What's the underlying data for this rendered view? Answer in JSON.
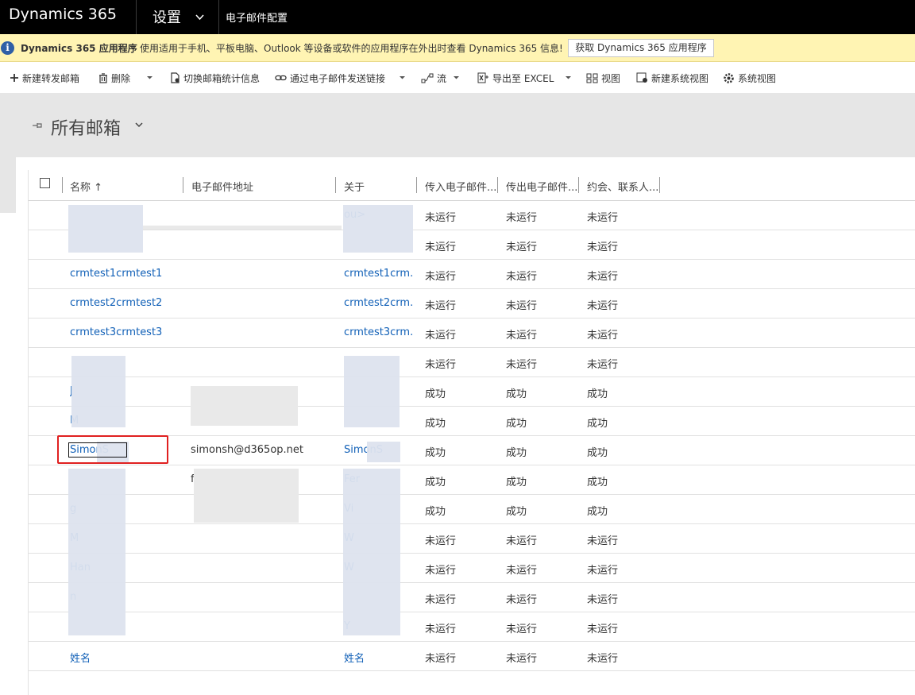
{
  "topbar": {
    "brand": "Dynamics 365",
    "area": "设置",
    "subarea": "电子邮件配置"
  },
  "notification": {
    "title": "Dynamics 365 应用程序",
    "message": "使用适用于手机、平板电脑、Outlook 等设备或软件的应用程序在外出时查看 Dynamics 365 信息!",
    "button": "获取 Dynamics 365 应用程序"
  },
  "toolbar": {
    "new_forward": "新建转发邮箱",
    "delete": "删除",
    "switch_stats": "切换邮箱统计信息",
    "email_link": "通过电子邮件发送链接",
    "flow": "流",
    "export": "导出至 EXCEL",
    "view": "视图",
    "new_system_view": "新建系统视图",
    "system_view": "系统视图"
  },
  "view": {
    "title": "所有邮箱"
  },
  "grid": {
    "columns": [
      "名称 ↑",
      "电子邮件地址",
      "关于",
      "传入电子邮件...",
      "传出电子邮件...",
      "约会、联系人..."
    ],
    "rows": [
      {
        "name": "",
        "email": "",
        "about": "ou>",
        "incoming": "未运行",
        "outgoing": "未运行",
        "appt": "未运行"
      },
      {
        "name": "",
        "email": "",
        "about": "",
        "incoming": "未运行",
        "outgoing": "未运行",
        "appt": "未运行"
      },
      {
        "name": "crmtest1crmtest1",
        "email": "",
        "about": "crmtest1crm...",
        "incoming": "未运行",
        "outgoing": "未运行",
        "appt": "未运行"
      },
      {
        "name": "crmtest2crmtest2",
        "email": "",
        "about": "crmtest2crm...",
        "incoming": "未运行",
        "outgoing": "未运行",
        "appt": "未运行"
      },
      {
        "name": "crmtest3crmtest3",
        "email": "",
        "about": "crmtest3crm...",
        "incoming": "未运行",
        "outgoing": "未运行",
        "appt": "未运行"
      },
      {
        "name": "",
        "email": "",
        "about": "",
        "incoming": "未运行",
        "outgoing": "未运行",
        "appt": "未运行"
      },
      {
        "name": "J",
        "email": "",
        "about": "",
        "incoming": "成功",
        "outgoing": "成功",
        "appt": "成功"
      },
      {
        "name": "M",
        "email": "",
        "about": "",
        "incoming": "成功",
        "outgoing": "成功",
        "appt": "成功"
      },
      {
        "name": "SimonS",
        "email": "simonsh@d365op.net",
        "about": "SimonS",
        "incoming": "成功",
        "outgoing": "成功",
        "appt": "成功"
      },
      {
        "name": "",
        "email": "f",
        "about": "Fer",
        "incoming": "成功",
        "outgoing": "成功",
        "appt": "成功"
      },
      {
        "name": "g",
        "email": "",
        "about": "Vi",
        "incoming": "成功",
        "outgoing": "成功",
        "appt": "成功"
      },
      {
        "name": "M",
        "email": "",
        "about": "W",
        "incoming": "未运行",
        "outgoing": "未运行",
        "appt": "未运行"
      },
      {
        "name": "Han",
        "email": "",
        "about": "W",
        "incoming": "未运行",
        "outgoing": "未运行",
        "appt": "未运行"
      },
      {
        "name": "n",
        "email": "",
        "about": "",
        "incoming": "未运行",
        "outgoing": "未运行",
        "appt": "未运行"
      },
      {
        "name": "",
        "email": "",
        "about": "Y",
        "incoming": "未运行",
        "outgoing": "未运行",
        "appt": "未运行"
      },
      {
        "name": "姓名",
        "email": "",
        "about": "姓名",
        "incoming": "未运行",
        "outgoing": "未运行",
        "appt": "未运行"
      }
    ]
  }
}
